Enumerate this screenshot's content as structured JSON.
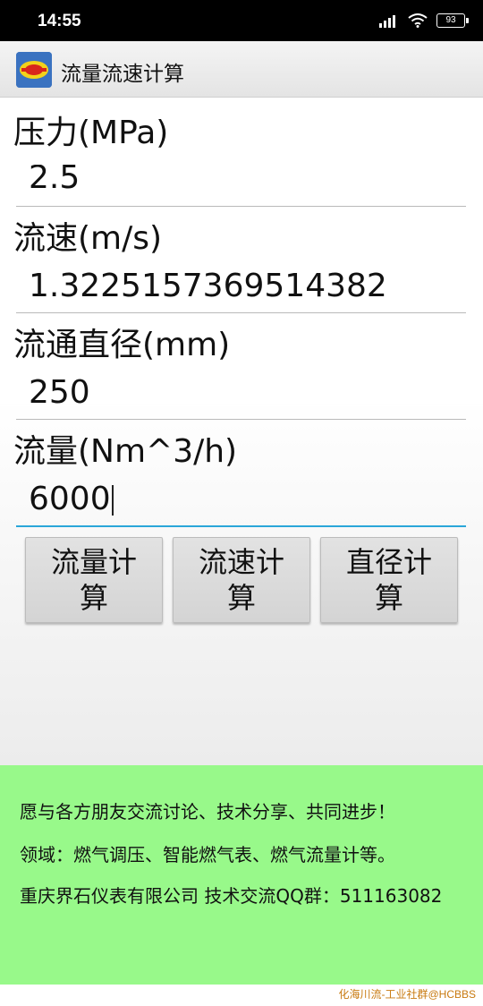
{
  "status_bar": {
    "time": "14:55",
    "battery": "93"
  },
  "app_bar": {
    "title": "流量流速计算",
    "icon": "app-logo-icon"
  },
  "fields": [
    {
      "label": "压力(MPa)",
      "value": "2.5"
    },
    {
      "label": "流速(m/s)",
      "value": "1.3225157369514382"
    },
    {
      "label": "流通直径(mm)",
      "value": "250"
    },
    {
      "label": "流量(Nm^3/h)",
      "value": "6000"
    }
  ],
  "buttons": {
    "flow_calc": "流量计算",
    "velocity_calc": "流速计算",
    "diameter_calc": "直径计算"
  },
  "info": {
    "line1": "愿与各方朋友交流讨论、技术分享、共同进步！",
    "line2": "领域：燃气调压、智能燃气表、燃气流量计等。",
    "line3": "重庆界石仪表有限公司  技术交流QQ群：511163082"
  },
  "watermark": "化海川流-工业社群@HCBBS",
  "colors": {
    "info_bg": "#98f98a",
    "focus_line": "#2aa6d9"
  }
}
